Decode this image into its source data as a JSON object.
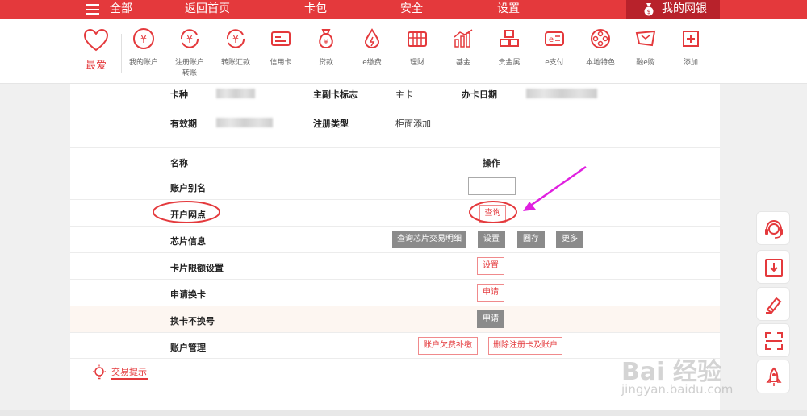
{
  "topnav": {
    "all": "全部",
    "home": "返回首页",
    "card_bag": "卡包",
    "security": "安全",
    "settings": "设置",
    "my_bank": "我的网银"
  },
  "iconbar": {
    "favorite": "最爱",
    "services": [
      {
        "label": "我的账户",
        "icon": "yuan-circle-icon"
      },
      {
        "label": "注册账户转账",
        "icon": "yuan-transfer-icon"
      },
      {
        "label": "转账汇款",
        "icon": "yuan-remit-icon"
      },
      {
        "label": "信用卡",
        "icon": "credit-card-icon"
      },
      {
        "label": "贷款",
        "icon": "money-bag-icon"
      },
      {
        "label": "e缴费",
        "icon": "drop-icon"
      },
      {
        "label": "理财",
        "icon": "abacus-icon"
      },
      {
        "label": "基金",
        "icon": "bar-chart-icon"
      },
      {
        "label": "贵金属",
        "icon": "gold-bars-icon"
      },
      {
        "label": "e支付",
        "icon": "e-pay-icon"
      },
      {
        "label": "本地特色",
        "icon": "film-reel-icon"
      },
      {
        "label": "融e购",
        "icon": "shopping-cart-icon"
      },
      {
        "label": "添加",
        "icon": "plus-icon"
      }
    ]
  },
  "card_info": {
    "card_type_label": "卡种",
    "primary_label": "主副卡标志",
    "primary_value": "主卡",
    "open_date_label": "办卡日期",
    "expiry_label": "有效期",
    "register_type_label": "注册类型",
    "register_type_value": "柜面添加"
  },
  "table": {
    "col_name": "名称",
    "col_action": "操作",
    "rows": [
      {
        "name": "账户别名"
      },
      {
        "name": "开户网点",
        "actions": [
          "查询"
        ]
      },
      {
        "name": "芯片信息",
        "actions": [
          "查询芯片交易明细",
          "设置",
          "圈存",
          "更多"
        ]
      },
      {
        "name": "卡片限额设置",
        "actions": [
          "设置"
        ]
      },
      {
        "name": "申请换卡",
        "actions": [
          "申请"
        ]
      },
      {
        "name": "换卡不换号",
        "actions": [
          "申请"
        ]
      },
      {
        "name": "账户管理",
        "actions": [
          "账户欠费补缴",
          "删除注册卡及账户"
        ]
      }
    ]
  },
  "tips": {
    "label": "交易提示"
  },
  "watermark": {
    "brand": "Bai 经验",
    "url": "jingyan.baidu.com"
  },
  "colors": {
    "brand_red": "#e4393c",
    "dark_red": "#b8222b",
    "annotation_magenta": "#e020e0"
  }
}
